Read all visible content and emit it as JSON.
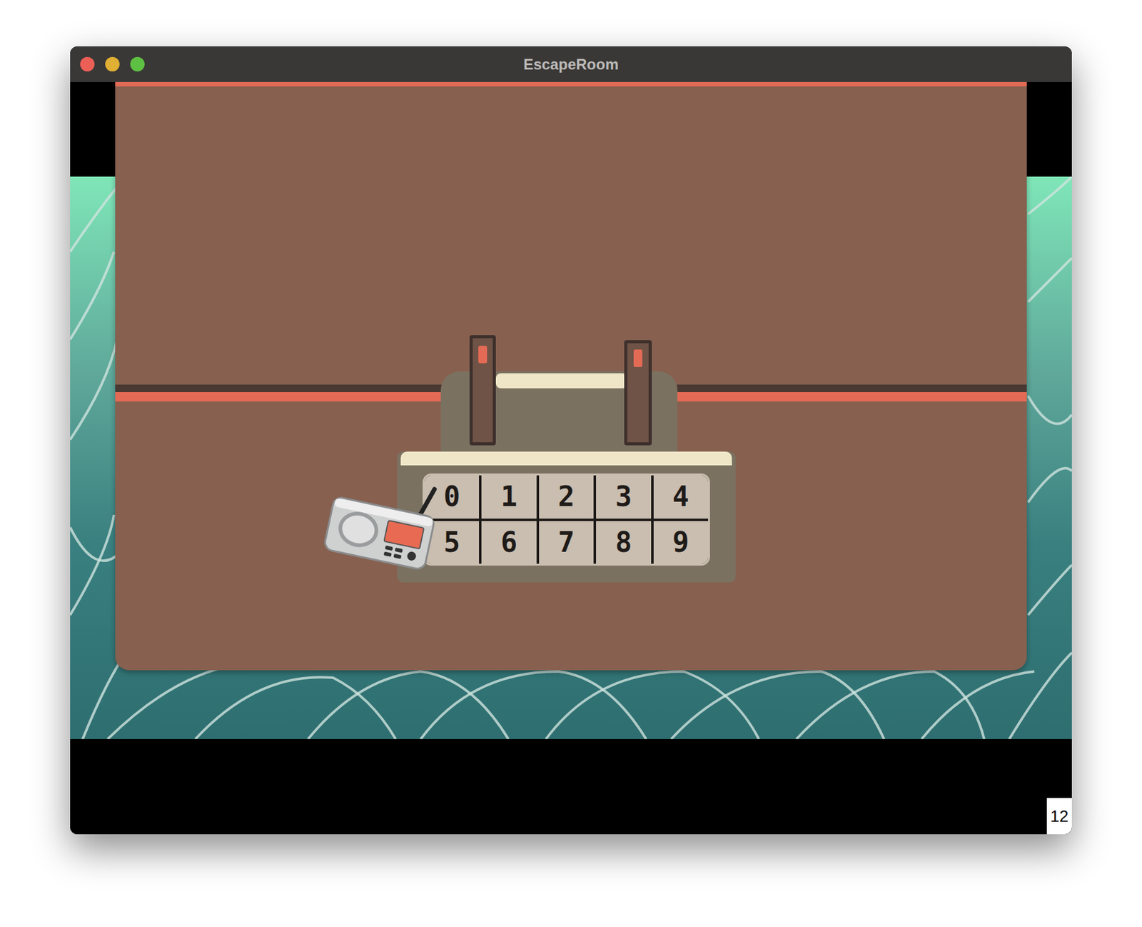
{
  "window": {
    "title": "EscapeRoom"
  },
  "keypad": {
    "keys": [
      "0",
      "1",
      "2",
      "3",
      "4",
      "5",
      "6",
      "7",
      "8",
      "9"
    ]
  },
  "counter": "12"
}
